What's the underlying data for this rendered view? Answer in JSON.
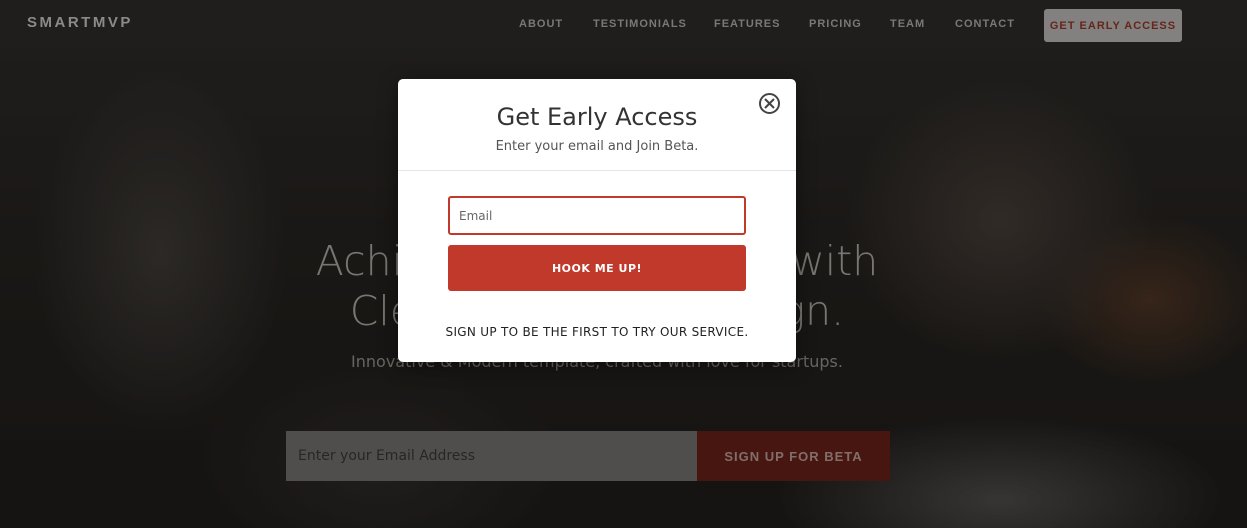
{
  "nav": {
    "logo": "SMARTMVP",
    "items": [
      "ABOUT",
      "TESTIMONIALS",
      "FEATURES",
      "PRICING",
      "TEAM",
      "CONTACT"
    ],
    "cta": "GET EARLY ACCESS"
  },
  "hero": {
    "title_line1": "Achieve Better Results with",
    "title_line2": "Clean & Modern Design.",
    "subtitle": "Innovative & Modern template, crafted with love for startups.",
    "email_placeholder": "Enter your Email Address",
    "button": "SIGN UP FOR BETA"
  },
  "modal": {
    "title": "Get Early Access",
    "subtitle": "Enter your email and Join Beta.",
    "email_placeholder": "Email",
    "button": "HOOK ME UP!",
    "note": "SIGN UP TO BE THE FIRST TO TRY OUR SERVICE.",
    "close_icon": "close-circle-icon"
  },
  "colors": {
    "accent": "#c0392b",
    "accent_dark": "#6e2219"
  }
}
